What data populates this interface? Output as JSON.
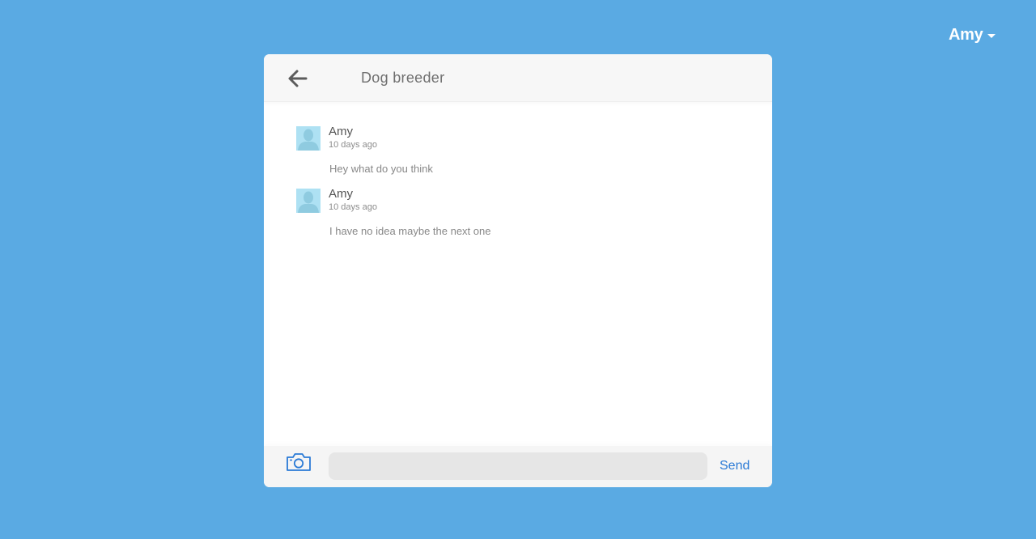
{
  "user_menu": {
    "username": "Amy",
    "icon": "caret-down-icon"
  },
  "chat": {
    "title": "Dog breeder",
    "back_icon": "arrow-left-icon",
    "messages": [
      {
        "author": "Amy",
        "time": "10 days ago",
        "text": "Hey what do you think",
        "avatar_icon": "default-avatar-icon"
      },
      {
        "author": "Amy",
        "time": "10 days ago",
        "text": "I have no idea maybe the next one",
        "avatar_icon": "default-avatar-icon"
      }
    ]
  },
  "composer": {
    "camera_icon": "camera-icon",
    "input_value": "",
    "input_placeholder": "",
    "send_label": "Send"
  },
  "colors": {
    "background": "#5aaae3",
    "accent": "#2a7ad6",
    "avatar_bg": "#aee1f3"
  }
}
